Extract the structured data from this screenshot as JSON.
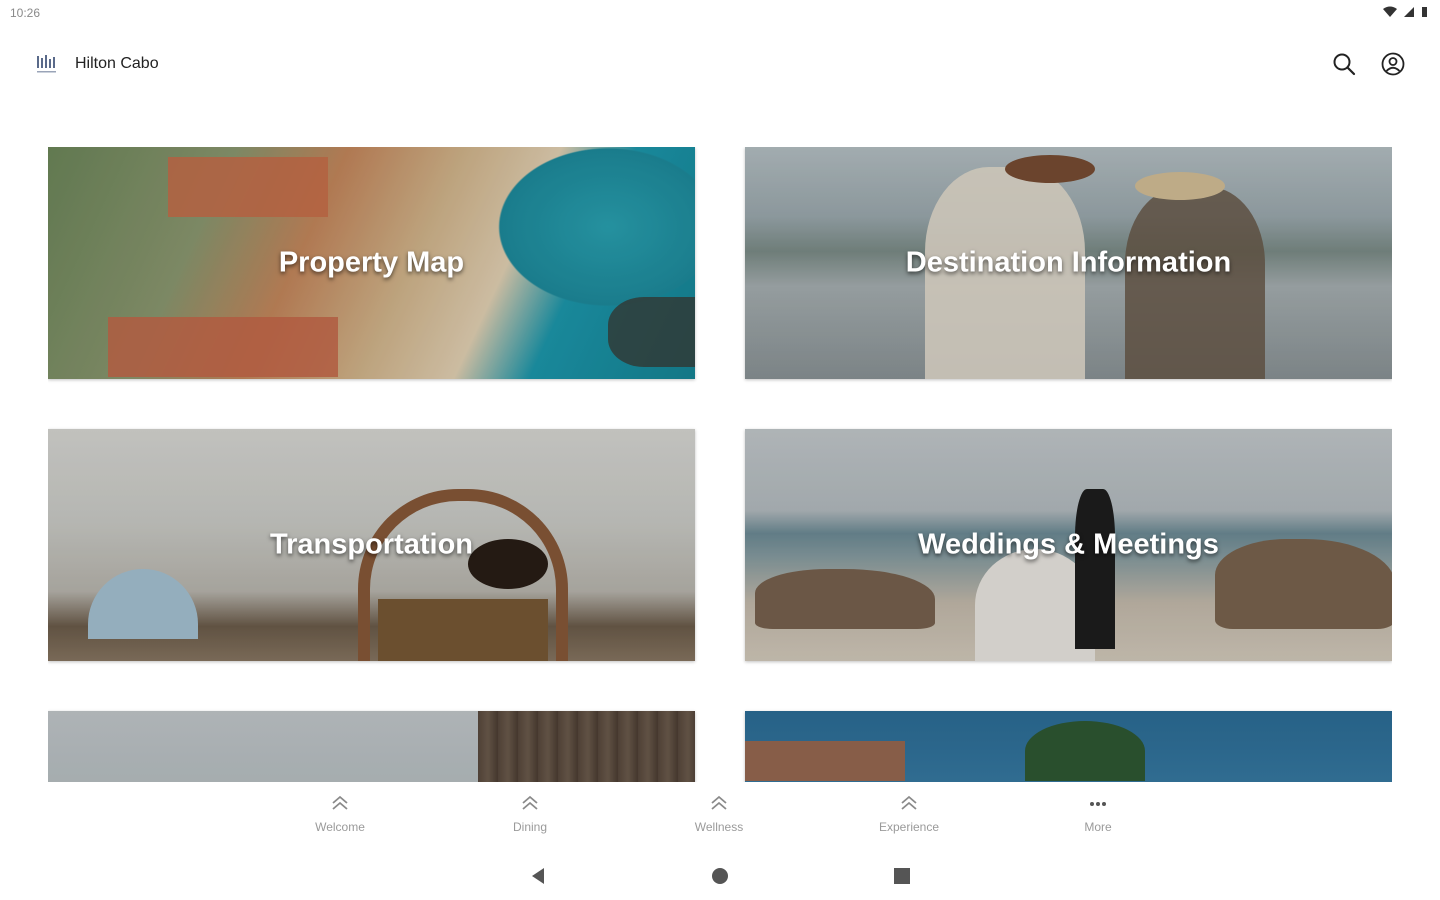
{
  "status_bar": {
    "time": "10:26"
  },
  "app_bar": {
    "title": "Hilton Cabo"
  },
  "tiles": [
    {
      "label": "Property Map"
    },
    {
      "label": "Destination Information"
    },
    {
      "label": "Transportation"
    },
    {
      "label": "Weddings & Meetings"
    },
    {
      "label": ""
    },
    {
      "label": ""
    }
  ],
  "bottom_nav": [
    {
      "label": "Welcome",
      "icon": "chevrons-up-icon"
    },
    {
      "label": "Dining",
      "icon": "chevrons-up-icon"
    },
    {
      "label": "Wellness",
      "icon": "chevrons-up-icon"
    },
    {
      "label": "Experience",
      "icon": "chevrons-up-icon"
    },
    {
      "label": "More",
      "icon": "more-dots-icon"
    }
  ],
  "colors": {
    "nav_label": "#9a9a9a",
    "title": "#222222"
  }
}
